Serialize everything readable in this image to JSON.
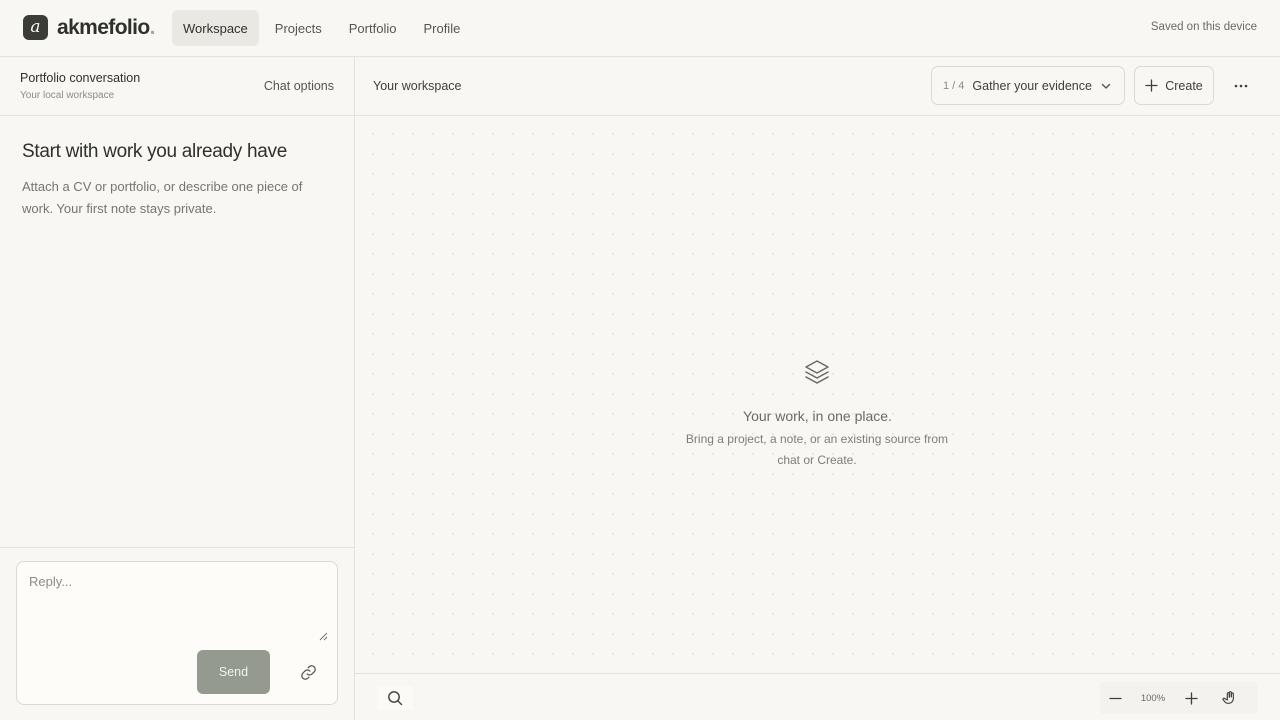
{
  "brand": {
    "mark": "a",
    "name": "akmefolio",
    "dot": "."
  },
  "nav": {
    "items": [
      {
        "label": "Workspace",
        "active": true
      },
      {
        "label": "Projects",
        "active": false
      },
      {
        "label": "Portfolio",
        "active": false
      },
      {
        "label": "Profile",
        "active": false
      }
    ],
    "status": "Saved on this device"
  },
  "chat": {
    "title": "Portfolio conversation",
    "subtitle": "Your local workspace",
    "options_label": "Chat options",
    "intro_title": "Start with work you already have",
    "intro_body": "Attach a CV or portfolio, or describe one piece of work. Your first note stays private.",
    "reply_placeholder": "Reply...",
    "reply_value": "",
    "send_label": "Send",
    "attach_icon": "link-icon"
  },
  "workspace": {
    "title": "Your workspace",
    "step": {
      "current": "1 / 4",
      "label": "Gather your evidence"
    },
    "create_label": "Create",
    "more_icon": "more-horizontal-icon",
    "empty": {
      "icon": "layers-icon",
      "title": "Your work, in one place.",
      "body": "Bring a project, a note, or an existing source from chat or Create."
    },
    "zoom": "100%"
  },
  "colors": {
    "background": "#f8f7f3",
    "text": "#2f302c",
    "muted": "#75766e",
    "border": "#e4e2dc",
    "send_button": "#949a8e",
    "active_nav": "#e9e8e3"
  }
}
